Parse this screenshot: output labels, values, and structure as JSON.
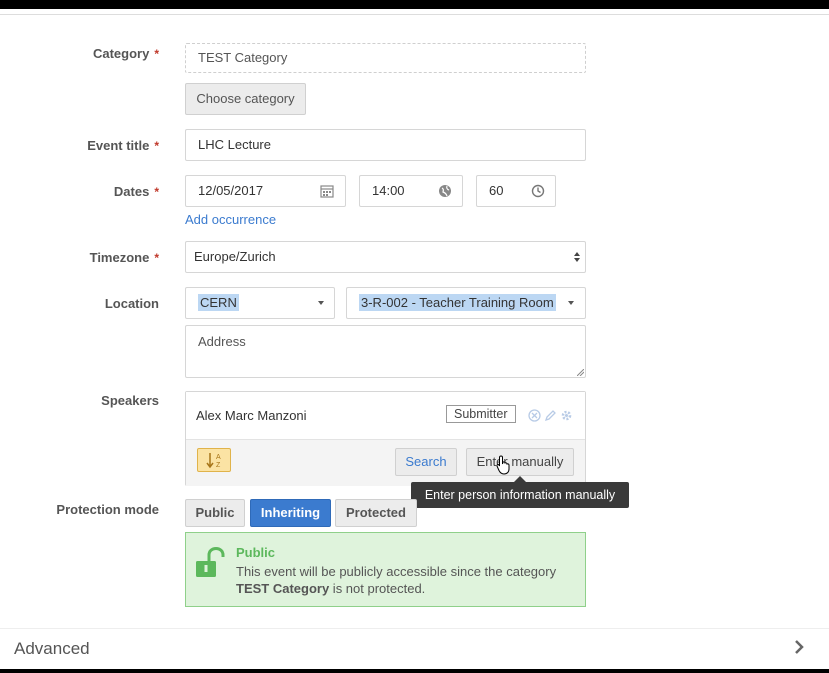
{
  "form": {
    "category": {
      "label": "Category",
      "required": "*",
      "value": "TEST Category",
      "choose_button": "Choose category"
    },
    "event_title": {
      "label": "Event title",
      "required": "*",
      "value": "LHC Lecture"
    },
    "dates": {
      "label": "Dates",
      "required": "*",
      "date": "12/05/2017",
      "time": "14:00",
      "duration": "60",
      "add_occurrence": "Add occurrence"
    },
    "timezone": {
      "label": "Timezone",
      "required": "*",
      "value": "Europe/Zurich"
    },
    "location": {
      "label": "Location",
      "venue": "CERN",
      "room": "3-R-002 - Teacher Training Room",
      "address_placeholder": "Address"
    },
    "speakers": {
      "label": "Speakers",
      "items": [
        {
          "name": "Alex Marc Manzoni",
          "badge": "Submitter"
        }
      ],
      "search_button": "Search",
      "enter_manually_button": "Enter manually",
      "tooltip": "Enter person information manually"
    },
    "protection": {
      "label": "Protection mode",
      "options": [
        "Public",
        "Inheriting",
        "Protected"
      ],
      "selected": "Inheriting",
      "info_title": "Public",
      "info_text_1": "This event will be publicly accessible since the category",
      "info_category": "TEST Category",
      "info_text_2": " is not protected."
    }
  },
  "advanced": {
    "label": "Advanced"
  },
  "colors": {
    "accent": "#3b7bcf",
    "required": "#c0392b",
    "success": "#5cb85c"
  }
}
